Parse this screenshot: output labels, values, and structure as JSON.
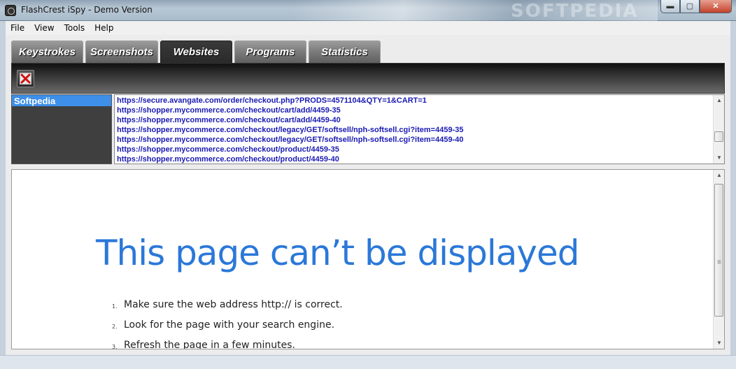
{
  "window": {
    "title": "FlashCrest iSpy - Demo Version",
    "watermark": "SOFTPEDIA",
    "buttons": {
      "minimize": "▬",
      "maximize": "▢",
      "close": "✕"
    }
  },
  "menu": {
    "items": [
      {
        "label": "File"
      },
      {
        "label": "View"
      },
      {
        "label": "Tools"
      },
      {
        "label": "Help"
      }
    ]
  },
  "tabs": [
    {
      "label": "Keystrokes",
      "active": false
    },
    {
      "label": "Screenshots",
      "active": false
    },
    {
      "label": "Websites",
      "active": true
    },
    {
      "label": "Programs",
      "active": false
    },
    {
      "label": "Statistics",
      "active": false
    }
  ],
  "toolbar": {
    "delete_icon": "red-x-icon"
  },
  "users": [
    {
      "label": "Softpedia",
      "selected": true
    }
  ],
  "urls": [
    "https://secure.avangate.com/order/checkout.php?PRODS=4571104&QTY=1&CART=1",
    "https://shopper.mycommerce.com/checkout/cart/add/4459-35",
    "https://shopper.mycommerce.com/checkout/cart/add/4459-40",
    "https://shopper.mycommerce.com/checkout/legacy/GET/softsell/nph-softsell.cgi?item=4459-35",
    "https://shopper.mycommerce.com/checkout/legacy/GET/softsell/nph-softsell.cgi?item=4459-40",
    "https://shopper.mycommerce.com/checkout/product/4459-35",
    "https://shopper.mycommerce.com/checkout/product/4459-40"
  ],
  "browser": {
    "error_title": "This page can’t be displayed",
    "suggestions": [
      {
        "num": "1.",
        "text": "Make sure the web address http:// is correct."
      },
      {
        "num": "2.",
        "text": "Look for the page with your search engine."
      },
      {
        "num": "3.",
        "text": "Refresh the page in a few minutes."
      }
    ]
  },
  "colors": {
    "url_text": "#1a1ab3",
    "selected_user": "#3d8fe8",
    "error_title": "#2b78d8"
  }
}
